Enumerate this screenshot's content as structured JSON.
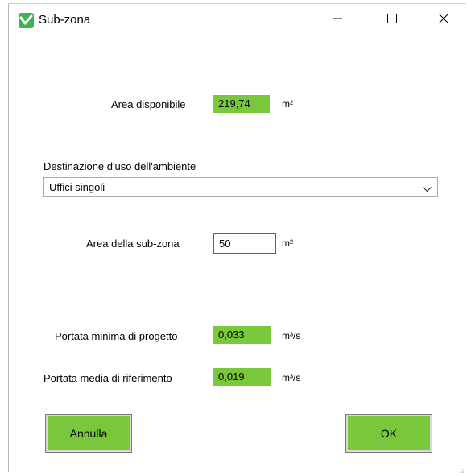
{
  "window": {
    "title": "Sub-zona",
    "icon": "app-logo-icon",
    "controls": {
      "minimize": "minimize-icon",
      "maximize": "maximize-icon",
      "close": "close-icon"
    }
  },
  "area_disponibile": {
    "label": "Area disponibile",
    "value": "219,74",
    "unit": "m²"
  },
  "destinazione": {
    "label": "Destinazione d'uso dell'ambiente",
    "selected": "Uffici singoli"
  },
  "area_subzona": {
    "label": "Area della sub-zona",
    "value": "50",
    "unit": "m²"
  },
  "portata_minima": {
    "label": "Portata minima di progetto",
    "value": "0,033",
    "unit": "m³/s"
  },
  "portata_media": {
    "label": "Portata media di riferimento",
    "value": "0,019",
    "unit": "m³/s"
  },
  "buttons": {
    "cancel": "Annulla",
    "ok": "OK"
  },
  "colors": {
    "accent": "#79c73b",
    "input_border": "#1e6fd0"
  }
}
